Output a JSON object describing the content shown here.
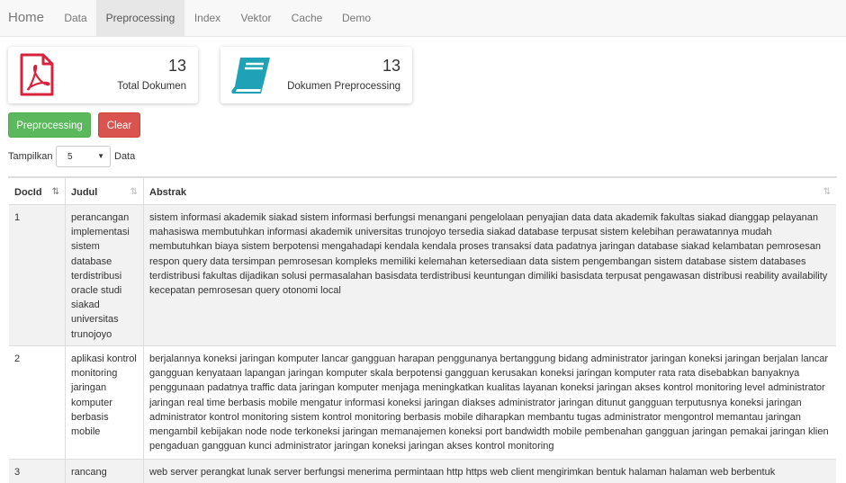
{
  "nav": {
    "brand": "Home",
    "items": [
      {
        "label": "Data"
      },
      {
        "label": "Preprocessing"
      },
      {
        "label": "Index"
      },
      {
        "label": "Vektor"
      },
      {
        "label": "Cache"
      },
      {
        "label": "Demo"
      }
    ],
    "active_index": 1
  },
  "stats": [
    {
      "value": "13",
      "label": "Total Dokumen",
      "icon": "pdf-file-icon",
      "color": "#d9233d"
    },
    {
      "value": "13",
      "label": "Dokumen Preprocessing",
      "icon": "book-icon",
      "color": "#1fa2b5"
    }
  ],
  "actions": {
    "preprocess_label": "Preprocessing",
    "clear_label": "Clear"
  },
  "length": {
    "prefix": "Tampilkan",
    "value": "5",
    "suffix": "Data"
  },
  "table": {
    "columns": [
      "DocId",
      "Judul",
      "Abstrak"
    ],
    "rows": [
      {
        "id": "1",
        "judul": "perancangan implementasi sistem database terdistribusi oracle studi siakad universitas trunojoyo",
        "abstrak": "sistem informasi akademik siakad sistem informasi berfungsi menangani pengelolaan penyajian data data akademik fakultas siakad dianggap pelayanan mahasiswa membutuhkan informasi akademik universitas trunojoyo tersedia siakad database terpusat sistem kelebihan perawatannya mudah membutuhkan biaya sistem berpotensi mengahadapi kendala kendala proses transaksi data padatnya jaringan database siakad kelambatan pemrosesan respon query data tersimpan pemrosesan kompleks memiliki kelemahan ketersediaan data sistem pengembangan sistem database sistem databases terdistribusi fakultas dijadikan solusi permasalahan basisdata terdistribusi keuntungan dimiliki basisdata terpusat pengawasan distribusi reability availability kecepatan pemrosesan query otonomi local"
      },
      {
        "id": "2",
        "judul": "aplikasi kontrol monitoring jaringan komputer berbasis mobile",
        "abstrak": "berjalannya koneksi jaringan komputer lancar gangguan harapan penggunanya bertanggung bidang administrator jaringan koneksi jaringan berjalan lancar gangguan kenyataan lapangan jaringan komputer skala berpotensi gangguan kerusakan koneksi jaringan komputer rata rata disebabkan banyaknya penggunaan padatnya traffic data jaringan komputer menjaga meningkatkan kualitas layanan koneksi jaringan akses kontrol monitoring level administrator jaringan real time berbasis mobile mengatur informasi koneksi jaringan diakses administrator jaringan ditunut gangguan terputusnya koneksi jaringan administrator kontrol monitoring sistem kontrol monitoring berbasis mobile diharapkan membantu tugas administrator mengontrol memantau jaringan mengambil kebijakan node node terkoneksi jaringan memanajemen koneksi port bandwidth mobile pembenahan gangguan jaringan pemakai jaringan klien pengaduan gangguan kunci administrator jaringan koneksi jaringan akses kontrol monitoring"
      },
      {
        "id": "3",
        "judul": "rancang",
        "abstrak": "web server perangkat lunak server berfungsi menerima permintaan http https web client mengirimkan bentuk halaman halaman web berbentuk"
      }
    ]
  }
}
